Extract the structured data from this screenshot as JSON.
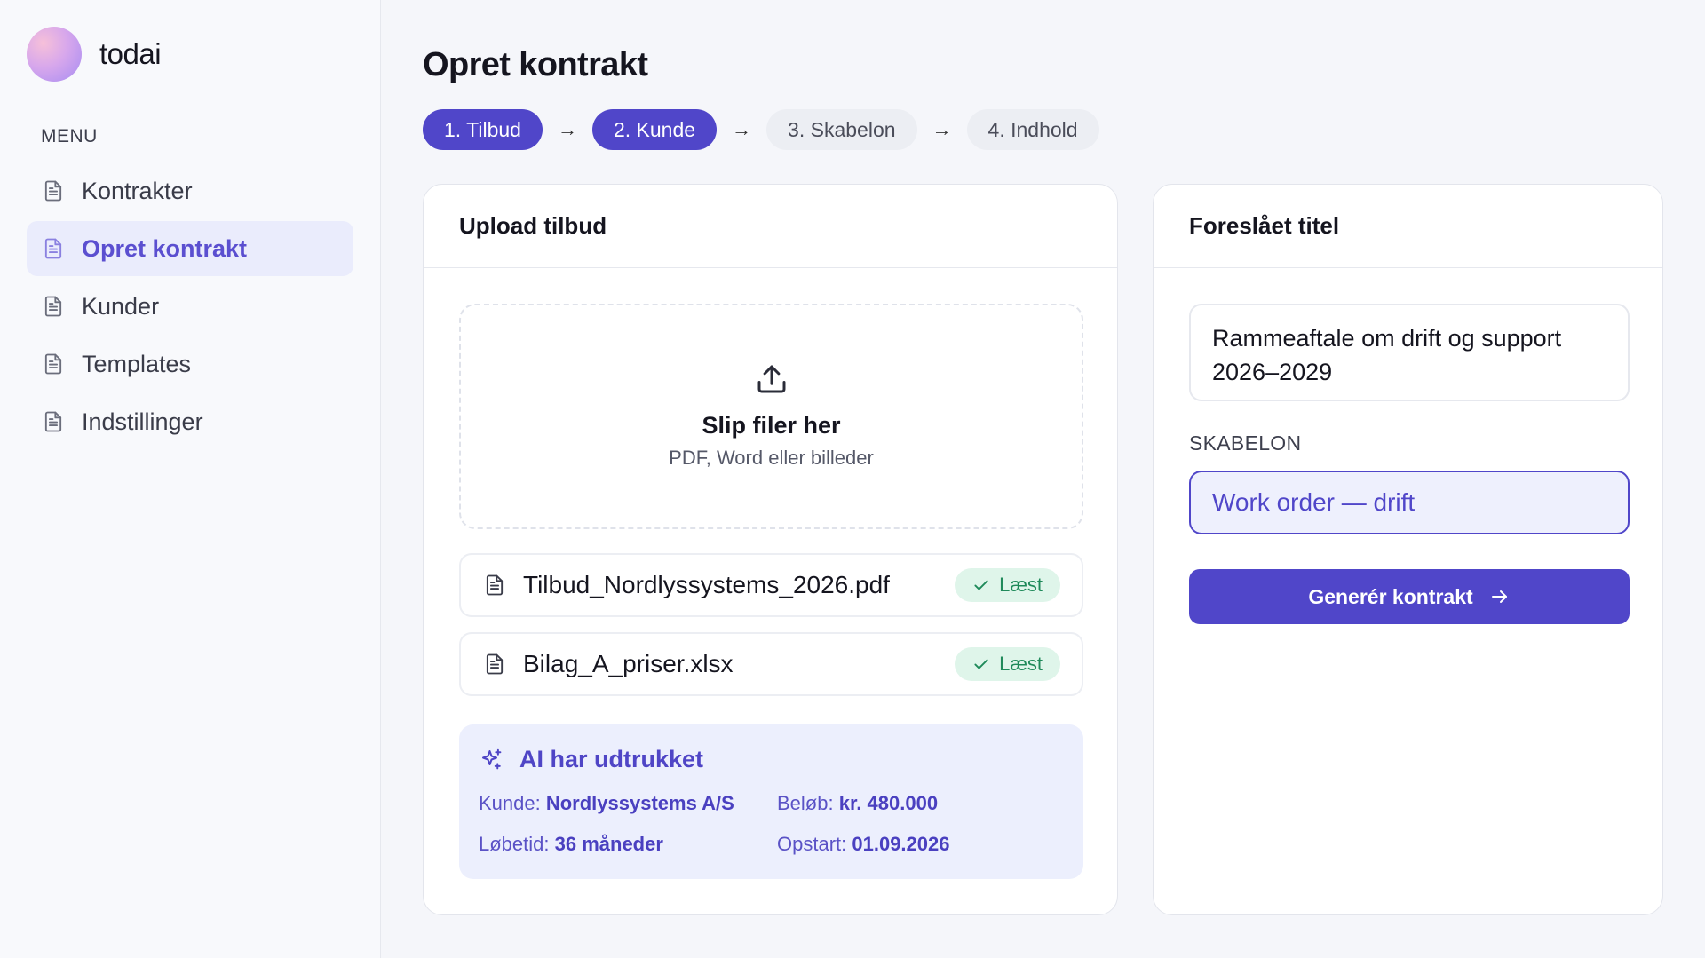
{
  "app": {
    "name": "todai"
  },
  "sidebar": {
    "menu_label": "MENU",
    "items": [
      {
        "label": "Kontrakter",
        "icon": "document-icon"
      },
      {
        "label": "Opret kontrakt",
        "icon": "document-icon",
        "active": true
      },
      {
        "label": "Kunder",
        "icon": "document-icon"
      },
      {
        "label": "Templates",
        "icon": "document-icon"
      },
      {
        "label": "Indstillinger",
        "icon": "document-icon"
      }
    ]
  },
  "page": {
    "title": "Opret kontrakt"
  },
  "steps": [
    {
      "label": "1. Tilbud",
      "active": true
    },
    {
      "label": "2. Kunde",
      "active": true
    },
    {
      "label": "3. Skabelon",
      "active": false
    },
    {
      "label": "4. Indhold",
      "active": false
    }
  ],
  "upload": {
    "header": "Upload tilbud",
    "dropzone_title": "Slip filer her",
    "dropzone_subtitle": "PDF, Word eller billeder",
    "files": [
      {
        "name": "Tilbud_Nordlyssystems_2026.pdf",
        "status": "Læst"
      },
      {
        "name": "Bilag_A_priser.xlsx",
        "status": "Læst"
      }
    ]
  },
  "ai": {
    "title": "AI har udtrukket",
    "fields": [
      {
        "label": "Kunde:",
        "value": "Nordlyssystems A/S"
      },
      {
        "label": "Beløb:",
        "value": "kr. 480.000"
      },
      {
        "label": "Løbetid:",
        "value": "36 måneder"
      },
      {
        "label": "Opstart:",
        "value": "01.09.2026"
      }
    ]
  },
  "suggestion": {
    "header": "Foreslået titel",
    "title_value": "Rammeaftale om drift og support 2026–2029",
    "template_label": "SKABELON",
    "template_value": "Work order — drift",
    "generate_label": "Generér kontrakt"
  },
  "colors": {
    "accent": "#5046c9",
    "success_bg": "#dff5ea",
    "success_text": "#1f8a5a",
    "ai_bg": "#eceffd"
  }
}
